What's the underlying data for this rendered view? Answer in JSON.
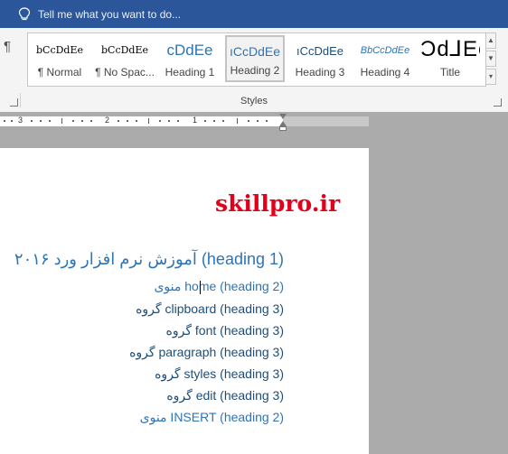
{
  "tellbar": {
    "text": "Tell me what you want to do..."
  },
  "ribbon": {
    "paragraph_mark": "¶",
    "styles_group_label": "Styles",
    "gallery": [
      {
        "preview": "bCcDdEe",
        "name": "¶ Normal"
      },
      {
        "preview": "bCcDdEe",
        "name": "¶ No Spac..."
      },
      {
        "preview": "cDdEe",
        "name": "Heading 1"
      },
      {
        "preview": "ıCcDdEe",
        "name": "Heading 2",
        "selected": true
      },
      {
        "preview": "ıCcDdEe",
        "name": "Heading 3"
      },
      {
        "preview": "BbCcDdEe",
        "name": "Heading 4"
      },
      {
        "preview": "Ͻd⅃Ee",
        "name": "Title"
      }
    ]
  },
  "ruler": {
    "labels": [
      "3",
      "2",
      "1"
    ]
  },
  "document": {
    "logo": "skillpro.ir",
    "lines": [
      {
        "text": "آموزش نرم افزار ورد ۲۰۱۶ (heading 1)",
        "style": "h1"
      },
      {
        "text": "منوی home (heading 2)",
        "style": "h2"
      },
      {
        "text": "گروه clipboard (heading 3)",
        "style": "h3"
      },
      {
        "text": "گروه font (heading 3)",
        "style": "h3"
      },
      {
        "text": "گروه paragraph (heading 3)",
        "style": "h3"
      },
      {
        "text": "گروه styles (heading 3)",
        "style": "h3"
      },
      {
        "text": "گروه edit (heading 3)",
        "style": "h3"
      },
      {
        "text": "منوی INSERT (heading  2)",
        "style": "h2"
      }
    ]
  },
  "colors": {
    "title_bar": "#2b579a",
    "heading_blue": "#2e74b5",
    "heading3_blue": "#1f4d78",
    "logo_red": "#e3001b"
  }
}
